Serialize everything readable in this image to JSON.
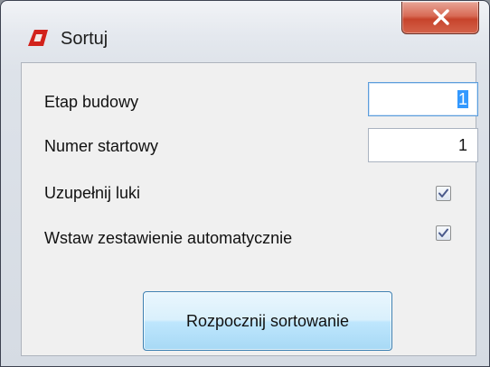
{
  "window": {
    "title": "Sortuj",
    "icon": "red-app-icon",
    "close_icon": "close-x-icon"
  },
  "form": {
    "etap_budowy": {
      "label": "Etap budowy",
      "value": "1"
    },
    "numer_startowy": {
      "label": "Numer startowy",
      "value": "1"
    },
    "uzupelnij_luki": {
      "label": "Uzupełnij luki",
      "checked": true
    },
    "wstaw_zestawienie": {
      "label": "Wstaw zestawienie automatycznie",
      "checked": true
    }
  },
  "actions": {
    "start_label": "Rozpocznij sortowanie"
  },
  "colors": {
    "accent": "#3399ff",
    "close_button": "#c7442c",
    "app_icon": "#d2221b",
    "checkmark": "#4a5a8c"
  }
}
